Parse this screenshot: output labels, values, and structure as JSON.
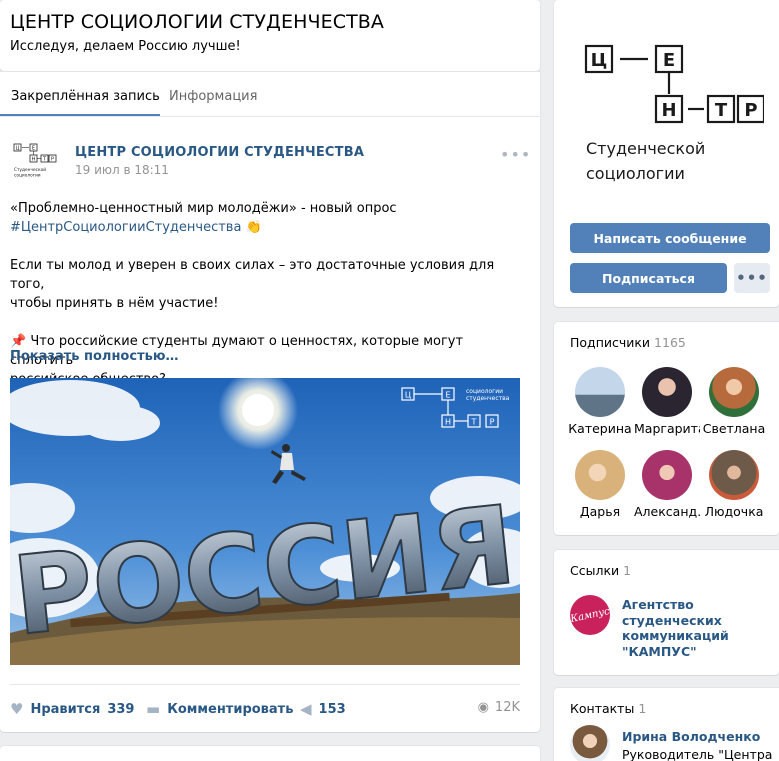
{
  "header": {
    "title": "ЦЕНТР СОЦИОЛОГИИ СТУДЕНЧЕСТВА",
    "status": "Исследуя, делаем Россию лучше!"
  },
  "tabs": [
    {
      "label": "Закреплённая запись",
      "active": true
    },
    {
      "label": "Информация",
      "active": false
    }
  ],
  "post": {
    "author": "ЦЕНТР СОЦИОЛОГИИ СТУДЕНЧЕСТВА",
    "date": "19 июл в 18:11",
    "line1": "«Проблемно-ценностный мир молодёжи» - новый опрос",
    "hashtag": "#ЦентрСоциологииСтуденчества",
    "hashtag_emoji": "👏",
    "line3": "Если ты молод и уверен в своих силах – это достаточные условия для того,",
    "line4": "чтобы принять в нём участие!",
    "pin_emoji": "📌",
    "line5": "Что российские студенты думают о ценностях, которые могут сплотить",
    "line6": "российское общество?",
    "show_more": "Показать полностью…",
    "image_sign": "РОССИЯ",
    "likes_label": "Нравится",
    "likes_count": "339",
    "comment_label": "Комментировать",
    "shares_count": "153",
    "views_count": "12K"
  },
  "logo": {
    "cells_top": [
      "Ц",
      "Е"
    ],
    "cells_bottom": [
      "Н",
      "Т",
      "Р"
    ],
    "caption_line1": "Студенческой",
    "caption_line2": "социологии",
    "small_caption_line1": "социологии",
    "small_caption_line2": "студенчества",
    "tiny_caption_line1": "Студенческой",
    "tiny_caption_line2": "социологии"
  },
  "group": {
    "message_button": "Написать сообщение",
    "subscribe_button": "Подписаться",
    "more_button": "•••"
  },
  "members": {
    "title": "Подписчики",
    "count": "1165",
    "items": [
      {
        "name": "Катерина",
        "color": "#8aa6c4"
      },
      {
        "name": "Маргарита",
        "color": "#3d3a4a"
      },
      {
        "name": "Светлана",
        "color": "#b76a3b"
      },
      {
        "name": "Дарья",
        "color": "#d8b27a"
      },
      {
        "name": "Александ…",
        "color": "#a8326a"
      },
      {
        "name": "Людочка",
        "color": "#6d5a48"
      }
    ]
  },
  "links": {
    "title": "Ссылки",
    "count": "1",
    "item_line1": "Агентство",
    "item_line2": "студенческих",
    "item_line3": "коммуникаций",
    "item_line4": "\"КАМПУС\"",
    "logo_text": "Кампус"
  },
  "contacts": {
    "title": "Контакты",
    "count": "1",
    "name": "Ирина Володченко",
    "role": "Руководитель \"Центра"
  },
  "colors": {
    "accent": "#5181b8",
    "link": "#2a5885",
    "background": "#edeef0"
  }
}
